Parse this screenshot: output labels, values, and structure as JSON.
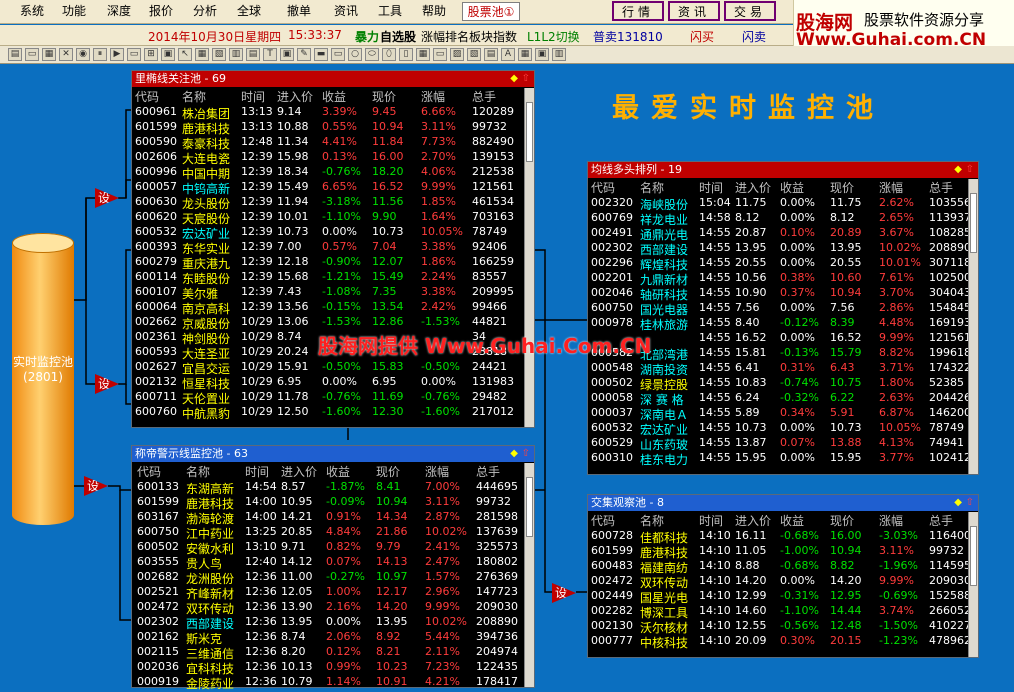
{
  "menu": [
    "系统",
    "功能",
    "深度",
    "报价",
    "分析",
    "全球",
    "撤单",
    "资讯",
    "工具",
    "帮助",
    "股票池"
  ],
  "menu_badge": "①",
  "nav": [
    "行情",
    "资讯",
    "交易"
  ],
  "logo": {
    "l1": "股海网",
    "l2": "股票软件资源分享",
    "l3": "Www.Guhai.com.CN"
  },
  "info": {
    "date": "2014年10月30日星期四",
    "time": "15:33:37",
    "f1": "暴力",
    "f2": "自选股",
    "f3": "涨幅排名板块指数",
    "f4": "L1L2切换",
    "f5": "普卖131810",
    "f6": "闪买",
    "f7": "闪卖"
  },
  "big_title": "最爱实时监控池",
  "watermark": "股海网提供 Www.Guhai.Com.CN",
  "cylinder": {
    "label": "实时监控池",
    "count": "(2801)"
  },
  "set_label": "设",
  "headers": [
    "代码",
    "名称",
    "时间",
    "进入价",
    "收益",
    "现价",
    "涨幅",
    "总手"
  ],
  "panels": [
    {
      "title": "里椭线关注池 - 69",
      "rows": [
        [
          "600961",
          "株冶集团",
          "13:13",
          "9.14",
          "3.39%",
          "9.45",
          "6.66%",
          "120289"
        ],
        [
          "601599",
          "鹿港科技",
          "13:13",
          "10.88",
          "0.55%",
          "10.94",
          "3.11%",
          "99732"
        ],
        [
          "600590",
          "泰豪科技",
          "12:48",
          "11.34",
          "4.41%",
          "11.84",
          "7.73%",
          "882490"
        ],
        [
          "002606",
          "大连电瓷",
          "12:39",
          "15.98",
          "0.13%",
          "16.00",
          "2.70%",
          "139153"
        ],
        [
          "600996",
          "中国中期",
          "12:39",
          "18.34",
          "-0.76%",
          "18.20",
          "4.06%",
          "212538"
        ],
        [
          "600057",
          "中钨高新",
          "12:39",
          "15.49",
          "6.65%",
          "16.52",
          "9.99%",
          "121561"
        ],
        [
          "600630",
          "龙头股份",
          "12:39",
          "11.94",
          "-3.18%",
          "11.56",
          "1.85%",
          "461534"
        ],
        [
          "600620",
          "天宸股份",
          "12:39",
          "10.01",
          "-1.10%",
          "9.90",
          "1.64%",
          "703163"
        ],
        [
          "600532",
          "宏达矿业",
          "12:39",
          "10.73",
          "0.00%",
          "10.73",
          "10.05%",
          "78749"
        ],
        [
          "600393",
          "东华实业",
          "12:39",
          "7.00",
          "0.57%",
          "7.04",
          "3.38%",
          "92406"
        ],
        [
          "600279",
          "重庆港九",
          "12:39",
          "12.18",
          "-0.90%",
          "12.07",
          "1.86%",
          "166259"
        ],
        [
          "600114",
          "东睦股份",
          "12:39",
          "15.68",
          "-1.21%",
          "15.49",
          "2.24%",
          "83557"
        ],
        [
          "600107",
          "美尔雅",
          "12:39",
          "7.43",
          "-1.08%",
          "7.35",
          "3.38%",
          "209995"
        ],
        [
          "600064",
          "南京高科",
          "12:39",
          "13.56",
          "-0.15%",
          "13.54",
          "2.42%",
          "99466"
        ],
        [
          "002662",
          "京威股份",
          "10/29",
          "13.06",
          "-1.53%",
          "12.86",
          "-1.53%",
          "44821"
        ],
        [
          "002361",
          "神剑股份",
          "10/29",
          "8.74",
          "",
          "",
          "",
          "34"
        ],
        [
          "600593",
          "大连圣亚",
          "10/29",
          "20.24",
          "",
          "",
          "",
          "23818"
        ],
        [
          "002627",
          "宜昌交运",
          "10/29",
          "15.91",
          "-0.50%",
          "15.83",
          "-0.50%",
          "24421"
        ],
        [
          "002132",
          "恒星科技",
          "10/29",
          "6.95",
          "0.00%",
          "6.95",
          "0.00%",
          "131983"
        ],
        [
          "600711",
          "天伦置业",
          "10/29",
          "11.78",
          "-0.76%",
          "11.69",
          "-0.76%",
          "29482"
        ],
        [
          "600760",
          "中航黑豹",
          "10/29",
          "12.50",
          "-1.60%",
          "12.30",
          "-1.60%",
          "217012"
        ]
      ]
    },
    {
      "title": "均线多头排列 - 19",
      "rows": [
        [
          "002320",
          "海峡股份",
          "15:04",
          "11.75",
          "0.00%",
          "11.75",
          "2.62%",
          "103556"
        ],
        [
          "600769",
          "祥龙电业",
          "14:58",
          "8.12",
          "0.00%",
          "8.12",
          "2.65%",
          "113937"
        ],
        [
          "002491",
          "通鼎光电",
          "14:55",
          "20.87",
          "0.10%",
          "20.89",
          "3.67%",
          "108285"
        ],
        [
          "002302",
          "西部建设",
          "14:55",
          "13.95",
          "0.00%",
          "13.95",
          "10.02%",
          "208890"
        ],
        [
          "002296",
          "辉煌科技",
          "14:55",
          "20.55",
          "0.00%",
          "20.55",
          "10.01%",
          "307118"
        ],
        [
          "002201",
          "九鼎新材",
          "14:55",
          "10.56",
          "0.38%",
          "10.60",
          "7.61%",
          "102500"
        ],
        [
          "002046",
          "轴研科技",
          "14:55",
          "10.90",
          "0.37%",
          "10.94",
          "3.70%",
          "304043"
        ],
        [
          "600750",
          "国光电器",
          "14:55",
          "7.56",
          "0.00%",
          "7.56",
          "2.86%",
          "154845"
        ],
        [
          "000978",
          "桂林旅游",
          "14:55",
          "8.40",
          "-0.12%",
          "8.39",
          "4.48%",
          "169193"
        ],
        [
          "",
          "",
          "14:55",
          "16.52",
          "0.00%",
          "16.52",
          "9.99%",
          "121561"
        ],
        [
          "000582",
          "北部湾港",
          "14:55",
          "15.81",
          "-0.13%",
          "15.79",
          "8.82%",
          "199618"
        ],
        [
          "000548",
          "湖南投资",
          "14:55",
          "6.41",
          "0.31%",
          "6.43",
          "3.71%",
          "174322"
        ],
        [
          "000502",
          "绿景控股",
          "14:55",
          "10.83",
          "-0.74%",
          "10.75",
          "1.80%",
          "52385"
        ],
        [
          "000058",
          "深 赛 格",
          "14:55",
          "6.24",
          "-0.32%",
          "6.22",
          "2.63%",
          "204426"
        ],
        [
          "000037",
          "深南电Ａ",
          "14:55",
          "5.89",
          "0.34%",
          "5.91",
          "6.87%",
          "146200"
        ],
        [
          "600532",
          "宏达矿业",
          "14:55",
          "10.73",
          "0.00%",
          "10.73",
          "10.05%",
          "78749"
        ],
        [
          "600529",
          "山东药玻",
          "14:55",
          "13.87",
          "0.07%",
          "13.88",
          "4.13%",
          "74941"
        ],
        [
          "600310",
          "桂东电力",
          "14:55",
          "15.95",
          "0.00%",
          "15.95",
          "3.77%",
          "102412"
        ]
      ]
    },
    {
      "title": "称帝警示线监控池 - 63",
      "rows": [
        [
          "600133",
          "东湖高新",
          "14:54",
          "8.57",
          "-1.87%",
          "8.41",
          "7.00%",
          "444695"
        ],
        [
          "601599",
          "鹿港科技",
          "14:00",
          "10.95",
          "-0.09%",
          "10.94",
          "3.11%",
          "99732"
        ],
        [
          "603167",
          "渤海轮渡",
          "14:00",
          "14.21",
          "0.91%",
          "14.34",
          "2.87%",
          "281598"
        ],
        [
          "600750",
          "江中药业",
          "13:25",
          "20.85",
          "4.84%",
          "21.86",
          "10.02%",
          "137639"
        ],
        [
          "600502",
          "安徽水利",
          "13:10",
          "9.71",
          "0.82%",
          "9.79",
          "2.41%",
          "325573"
        ],
        [
          "603555",
          "贵人鸟",
          "12:40",
          "14.12",
          "0.07%",
          "14.13",
          "2.47%",
          "180802"
        ],
        [
          "002682",
          "龙洲股份",
          "12:36",
          "11.00",
          "-0.27%",
          "10.97",
          "1.57%",
          "276369"
        ],
        [
          "002521",
          "齐峰新材",
          "12:36",
          "12.05",
          "1.00%",
          "12.17",
          "2.96%",
          "147723"
        ],
        [
          "002472",
          "双环传动",
          "12:36",
          "13.90",
          "2.16%",
          "14.20",
          "9.99%",
          "209030"
        ],
        [
          "002302",
          "西部建设",
          "12:36",
          "13.95",
          "0.00%",
          "13.95",
          "10.02%",
          "208890"
        ],
        [
          "002162",
          "斯米克",
          "12:36",
          "8.74",
          "2.06%",
          "8.92",
          "5.44%",
          "394736"
        ],
        [
          "002115",
          "三维通信",
          "12:36",
          "8.20",
          "0.12%",
          "8.21",
          "2.11%",
          "204974"
        ],
        [
          "002036",
          "宜科科技",
          "12:36",
          "10.13",
          "0.99%",
          "10.23",
          "7.23%",
          "122435"
        ],
        [
          "000919",
          "金陵药业",
          "12:36",
          "10.79",
          "1.14%",
          "10.91",
          "4.21%",
          "178417"
        ]
      ]
    },
    {
      "title": "交集观察池 - 8",
      "rows": [
        [
          "600728",
          "佳都科技",
          "14:10",
          "16.11",
          "-0.68%",
          "16.00",
          "-3.03%",
          "116400"
        ],
        [
          "601599",
          "鹿港科技",
          "14:10",
          "11.05",
          "-1.00%",
          "10.94",
          "3.11%",
          "99732"
        ],
        [
          "600483",
          "福建南纺",
          "14:10",
          "8.88",
          "-0.68%",
          "8.82",
          "-1.96%",
          "114595"
        ],
        [
          "002472",
          "双环传动",
          "14:10",
          "14.20",
          "0.00%",
          "14.20",
          "9.99%",
          "209030"
        ],
        [
          "002449",
          "国星光电",
          "14:10",
          "12.99",
          "-0.31%",
          "12.95",
          "-0.69%",
          "152588"
        ],
        [
          "002282",
          "博深工具",
          "14:10",
          "14.60",
          "-1.10%",
          "14.44",
          "3.74%",
          "266052"
        ],
        [
          "002130",
          "沃尔核材",
          "14:10",
          "12.55",
          "-0.56%",
          "12.48",
          "-1.50%",
          "410227"
        ],
        [
          "000777",
          "中核科技",
          "14:10",
          "20.09",
          "0.30%",
          "20.15",
          "-1.23%",
          "478962"
        ]
      ]
    }
  ],
  "icons": {
    "diamond": "◆",
    "arrow": "⇧"
  },
  "colors": {
    "bg": "#0b6fc0",
    "title_red": "#c00000",
    "title_blue": "#1f5fd0",
    "up": "#ff3c3c",
    "down": "#00e000"
  }
}
